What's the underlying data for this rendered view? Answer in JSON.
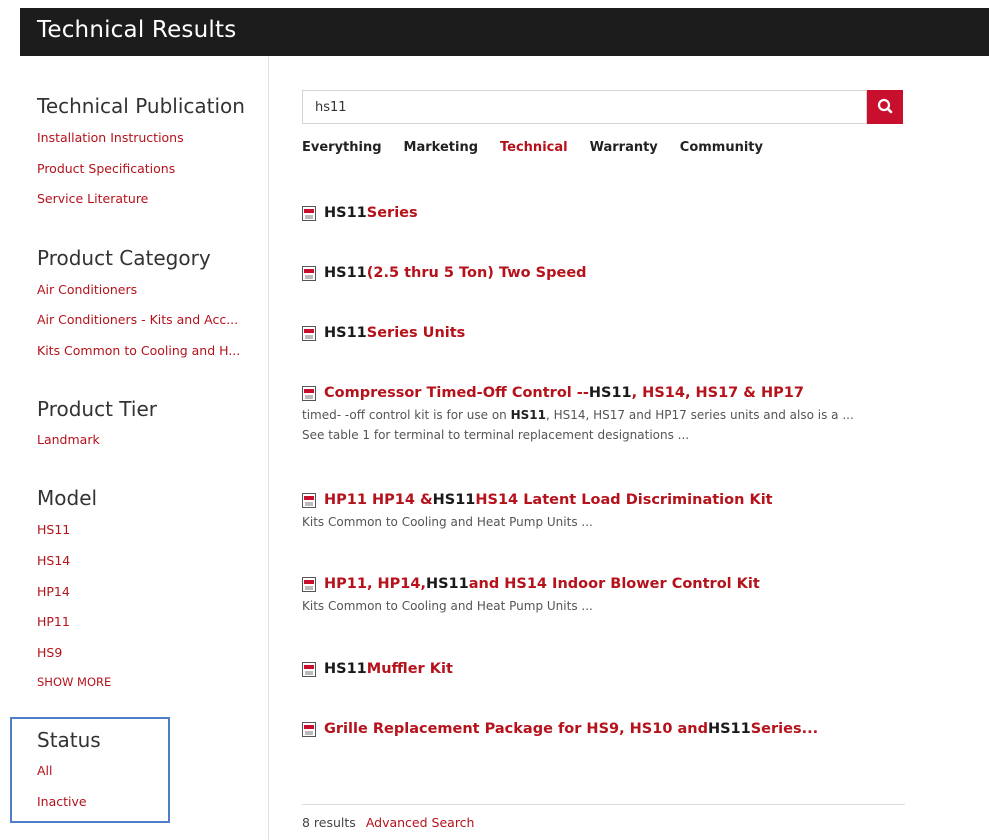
{
  "header": {
    "title": "Technical Results"
  },
  "sidebar": {
    "groups": [
      {
        "title": "Technical Publication",
        "items": [
          "Installation Instructions",
          "Product Specifications",
          "Service Literature"
        ]
      },
      {
        "title": "Product Category",
        "items": [
          "Air Conditioners",
          "Air Conditioners - Kits and Acc...",
          "Kits Common to Cooling and H..."
        ]
      },
      {
        "title": "Product Tier",
        "items": [
          "Landmark"
        ]
      },
      {
        "title": "Model",
        "items": [
          "HS11",
          "HS14",
          "HP14",
          "HP11",
          "HS9"
        ],
        "show_more": "SHOW MORE"
      },
      {
        "title": "Status",
        "items": [
          "All",
          "Inactive"
        ]
      }
    ]
  },
  "search": {
    "value": "hs11",
    "button_icon": "search-icon"
  },
  "tabs": [
    "Everything",
    "Marketing",
    "Technical",
    "Warranty",
    "Community"
  ],
  "active_tab": "Technical",
  "results": [
    {
      "title": [
        {
          "t": "HS11",
          "hl": true
        },
        {
          "t": " Series",
          "hl": false
        }
      ]
    },
    {
      "title": [
        {
          "t": "HS11",
          "hl": true
        },
        {
          "t": " (2.5 thru 5 Ton) Two Speed",
          "hl": false
        }
      ]
    },
    {
      "title": [
        {
          "t": "HS11",
          "hl": true
        },
        {
          "t": " Series Units",
          "hl": false
        }
      ]
    },
    {
      "title": [
        {
          "t": "Compressor Timed-Off Control -- ",
          "hl": false
        },
        {
          "t": "HS11",
          "hl": true
        },
        {
          "t": ", HS14, HS17 & HP17",
          "hl": false
        }
      ],
      "snippet": [
        "timed- -off control kit is for use on ",
        "HS11",
        ", HS14, HS17 and HP17 series units and also is a ... See table 1 for terminal to terminal replacement designations ..."
      ]
    },
    {
      "title": [
        {
          "t": "HP11 HP14 & ",
          "hl": false
        },
        {
          "t": "HS11",
          "hl": true
        },
        {
          "t": " HS14 Latent Load Discrimination Kit",
          "hl": false
        }
      ],
      "snippet": [
        "Kits Common to Cooling and Heat Pump Units ...",
        "",
        ""
      ]
    },
    {
      "title": [
        {
          "t": "HP11, HP14, ",
          "hl": false
        },
        {
          "t": "HS11",
          "hl": true
        },
        {
          "t": " and HS14 Indoor Blower Control Kit",
          "hl": false
        }
      ],
      "snippet": [
        "Kits Common to Cooling and Heat Pump Units ...",
        "",
        ""
      ]
    },
    {
      "title": [
        {
          "t": "HS11",
          "hl": true
        },
        {
          "t": " Muffler Kit",
          "hl": false
        }
      ]
    },
    {
      "title": [
        {
          "t": "Grille Replacement Package for HS9, HS10 and ",
          "hl": false
        },
        {
          "t": "HS11",
          "hl": true
        },
        {
          "t": " Series...",
          "hl": false
        }
      ]
    }
  ],
  "footer": {
    "count": "8 results",
    "advanced": "Advanced Search"
  },
  "colors": {
    "accent": "#b5121b",
    "header_bg": "#1c1c1c",
    "status_box": "#4f7ec7"
  }
}
